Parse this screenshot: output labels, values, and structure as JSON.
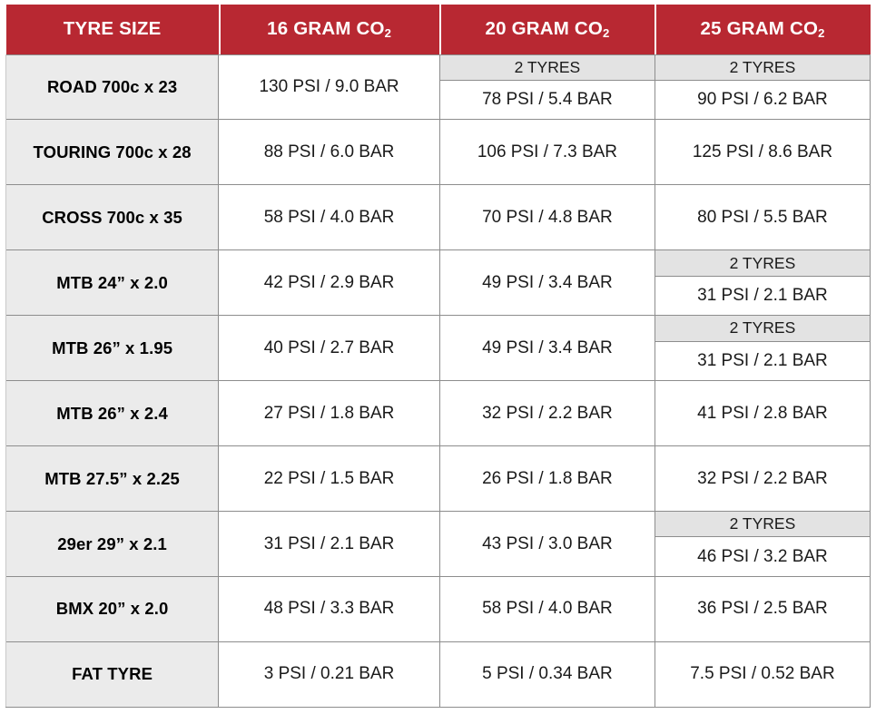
{
  "table": {
    "columns": [
      {
        "id": "tyre_size",
        "label": "TYRE SIZE",
        "prefix": "",
        "co2": false
      },
      {
        "id": "co2_16",
        "label": "16 GRAM CO",
        "sub": "2",
        "co2": true
      },
      {
        "id": "co2_20",
        "label": "20 GRAM CO",
        "sub": "2",
        "co2": true
      },
      {
        "id": "co2_25",
        "label": "25 GRAM CO",
        "sub": "2",
        "co2": true
      }
    ],
    "two_tyres_label": "2 TYRES",
    "rows": [
      {
        "label": "ROAD 700c x 23",
        "cells": [
          {
            "value": "130 PSI / 9.0 BAR",
            "two_tyres": false
          },
          {
            "value": "78 PSI / 5.4 BAR",
            "two_tyres": true
          },
          {
            "value": "90 PSI / 6.2 BAR",
            "two_tyres": true
          }
        ]
      },
      {
        "label": "TOURING 700c x 28",
        "cells": [
          {
            "value": "88 PSI / 6.0 BAR",
            "two_tyres": false
          },
          {
            "value": "106 PSI / 7.3 BAR",
            "two_tyres": false
          },
          {
            "value": "125 PSI / 8.6 BAR",
            "two_tyres": false
          }
        ]
      },
      {
        "label": "CROSS 700c x 35",
        "cells": [
          {
            "value": "58 PSI / 4.0 BAR",
            "two_tyres": false
          },
          {
            "value": "70 PSI / 4.8 BAR",
            "two_tyres": false
          },
          {
            "value": "80 PSI / 5.5 BAR",
            "two_tyres": false
          }
        ]
      },
      {
        "label": "MTB 24” x 2.0",
        "cells": [
          {
            "value": "42 PSI / 2.9 BAR",
            "two_tyres": false
          },
          {
            "value": "49 PSI / 3.4 BAR",
            "two_tyres": false
          },
          {
            "value": "31 PSI / 2.1 BAR",
            "two_tyres": true
          }
        ]
      },
      {
        "label": "MTB 26” x 1.95",
        "cells": [
          {
            "value": "40 PSI / 2.7 BAR",
            "two_tyres": false
          },
          {
            "value": "49 PSI / 3.4 BAR",
            "two_tyres": false
          },
          {
            "value": "31 PSI / 2.1 BAR",
            "two_tyres": true
          }
        ]
      },
      {
        "label": "MTB 26” x 2.4",
        "cells": [
          {
            "value": "27 PSI / 1.8 BAR",
            "two_tyres": false
          },
          {
            "value": "32 PSI / 2.2 BAR",
            "two_tyres": false
          },
          {
            "value": "41 PSI / 2.8 BAR",
            "two_tyres": false
          }
        ]
      },
      {
        "label": "MTB 27.5” x 2.25",
        "cells": [
          {
            "value": "22 PSI / 1.5 BAR",
            "two_tyres": false
          },
          {
            "value": "26 PSI / 1.8 BAR",
            "two_tyres": false
          },
          {
            "value": "32 PSI / 2.2 BAR",
            "two_tyres": false
          }
        ]
      },
      {
        "label": "29er 29” x 2.1",
        "cells": [
          {
            "value": "31 PSI / 2.1 BAR",
            "two_tyres": false
          },
          {
            "value": "43 PSI / 3.0 BAR",
            "two_tyres": false
          },
          {
            "value": "46 PSI / 3.2 BAR",
            "two_tyres": true
          }
        ]
      },
      {
        "label": "BMX 20” x 2.0",
        "cells": [
          {
            "value": "48 PSI / 3.3 BAR",
            "two_tyres": false
          },
          {
            "value": "58 PSI / 4.0 BAR",
            "two_tyres": false
          },
          {
            "value": "36 PSI / 2.5 BAR",
            "two_tyres": false
          }
        ]
      },
      {
        "label": "FAT TYRE",
        "cells": [
          {
            "value": "3 PSI / 0.21 BAR",
            "two_tyres": false
          },
          {
            "value": "5 PSI / 0.34 BAR",
            "two_tyres": false
          },
          {
            "value": "7.5 PSI / 0.52 BAR",
            "two_tyres": false
          }
        ]
      }
    ]
  },
  "colors": {
    "header_red": "#b82832",
    "header_text": "#ffffff",
    "label_cell_bg": "#ebebeb",
    "value_cell_bg": "#ffffff",
    "two_tyres_bg": "#e3e3e3",
    "grid_line": "#8d8d8d",
    "body_text": "#1a1a1a"
  }
}
